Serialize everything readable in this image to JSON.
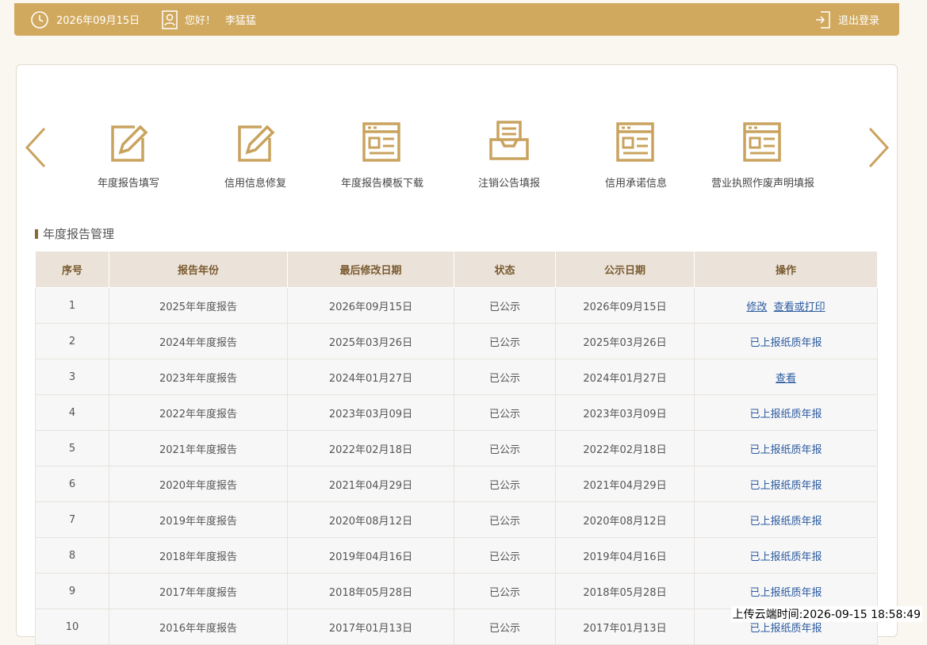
{
  "header": {
    "date": "2026年09月15日",
    "greeting": "您好！",
    "username": "李猛猛",
    "logout_label": "退出登录"
  },
  "menu": {
    "items": [
      {
        "label": "年度报告填写",
        "icon": "edit-icon"
      },
      {
        "label": "信用信息修复",
        "icon": "edit-icon"
      },
      {
        "label": "年度报告模板下载",
        "icon": "template-icon"
      },
      {
        "label": "注销公告填报",
        "icon": "inbox-icon"
      },
      {
        "label": "信用承诺信息",
        "icon": "template-icon"
      },
      {
        "label": "营业执照作废声明填报",
        "icon": "template-icon"
      }
    ]
  },
  "section": {
    "title": "年度报告管理"
  },
  "table": {
    "columns": [
      "序号",
      "报告年份",
      "最后修改日期",
      "状态",
      "公示日期",
      "操作"
    ],
    "rows": [
      {
        "no": "1",
        "year": "2025年年度报告",
        "modified": "2026年09月15日",
        "status": "已公示",
        "published": "2026年09月15日",
        "actions": [
          "修改",
          "查看或打印"
        ]
      },
      {
        "no": "2",
        "year": "2024年年度报告",
        "modified": "2025年03月26日",
        "status": "已公示",
        "published": "2025年03月26日",
        "actions": [
          "已上报纸质年报"
        ]
      },
      {
        "no": "3",
        "year": "2023年年度报告",
        "modified": "2024年01月27日",
        "status": "已公示",
        "published": "2024年01月27日",
        "actions": [
          "查看"
        ]
      },
      {
        "no": "4",
        "year": "2022年年度报告",
        "modified": "2023年03月09日",
        "status": "已公示",
        "published": "2023年03月09日",
        "actions": [
          "已上报纸质年报"
        ]
      },
      {
        "no": "5",
        "year": "2021年年度报告",
        "modified": "2022年02月18日",
        "status": "已公示",
        "published": "2022年02月18日",
        "actions": [
          "已上报纸质年报"
        ]
      },
      {
        "no": "6",
        "year": "2020年年度报告",
        "modified": "2021年04月29日",
        "status": "已公示",
        "published": "2021年04月29日",
        "actions": [
          "已上报纸质年报"
        ]
      },
      {
        "no": "7",
        "year": "2019年年度报告",
        "modified": "2020年08月12日",
        "status": "已公示",
        "published": "2020年08月12日",
        "actions": [
          "已上报纸质年报"
        ]
      },
      {
        "no": "8",
        "year": "2018年年度报告",
        "modified": "2019年04月16日",
        "status": "已公示",
        "published": "2019年04月16日",
        "actions": [
          "已上报纸质年报"
        ]
      },
      {
        "no": "9",
        "year": "2017年年度报告",
        "modified": "2018年05月28日",
        "status": "已公示",
        "published": "2018年05月28日",
        "actions": [
          "已上报纸质年报"
        ]
      },
      {
        "no": "10",
        "year": "2016年年度报告",
        "modified": "2017年01月13日",
        "status": "已公示",
        "published": "2017年01月13日",
        "actions": [
          "已上报纸质年报"
        ]
      }
    ]
  },
  "footer": {
    "upload_time": "上传云端时间:2026-09-15 18:58:49"
  },
  "colors": {
    "accent": "#d1a95e",
    "link": "#2c5ba0",
    "header_bg": "#ebe3da"
  }
}
